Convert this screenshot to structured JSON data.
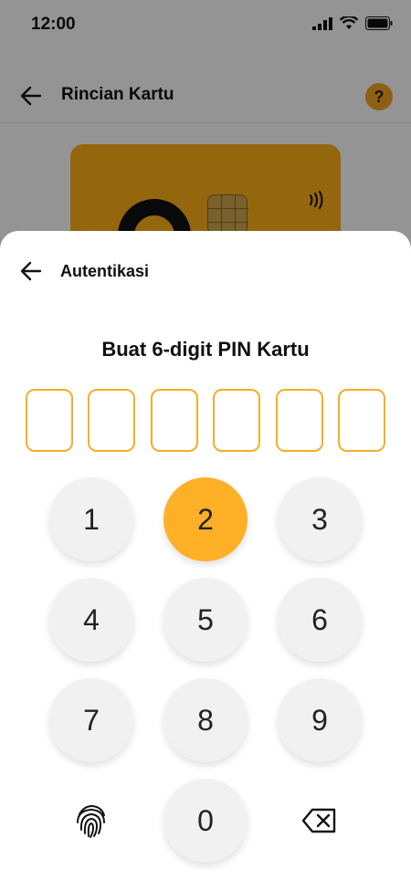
{
  "status_bar": {
    "time": "12:00"
  },
  "header": {
    "title": "Rincian Kartu",
    "help_label": "?"
  },
  "sheet": {
    "title": "Autentikasi",
    "heading": "Buat 6-digit PIN Kartu",
    "pin_length": 6
  },
  "keypad": {
    "keys": [
      "1",
      "2",
      "3",
      "4",
      "5",
      "6",
      "7",
      "8",
      "9",
      "0"
    ],
    "active_key": "2"
  },
  "colors": {
    "accent": "#ffb026",
    "pin_border": "#f5ae2a",
    "key_bg": "#f1f1f1",
    "card": "#ffb018"
  }
}
